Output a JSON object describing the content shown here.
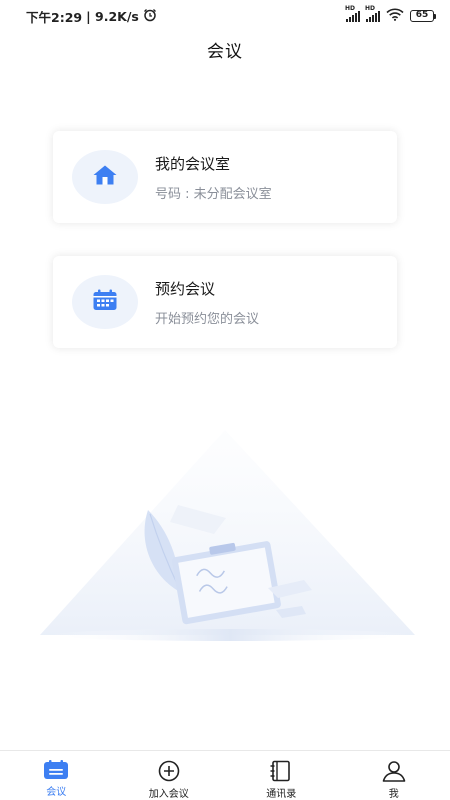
{
  "status_bar": {
    "time": "下午2:29",
    "speed": "| 9.2K/s",
    "battery": "65",
    "icons": [
      "alarm-icon",
      "signal-icon",
      "signal-icon",
      "wifi-icon",
      "battery-icon"
    ]
  },
  "header": {
    "title": "会议"
  },
  "cards": [
    {
      "title": "我的会议室",
      "subtitle": "号码 : 未分配会议室",
      "icon": "home-icon"
    },
    {
      "title": "预约会议",
      "subtitle": "开始预约您的会议",
      "icon": "calendar-icon"
    }
  ],
  "nav": [
    {
      "label": "会议",
      "icon": "meeting-icon",
      "active": true
    },
    {
      "label": "加入会议",
      "icon": "plus-circle-icon",
      "active": false
    },
    {
      "label": "通讯录",
      "icon": "contacts-icon",
      "active": false
    },
    {
      "label": "我",
      "icon": "person-icon",
      "active": false
    }
  ],
  "colors": {
    "accent": "#3d7ff2",
    "icon_bg": "#eef3fb",
    "subtitle": "#8a8f99"
  }
}
